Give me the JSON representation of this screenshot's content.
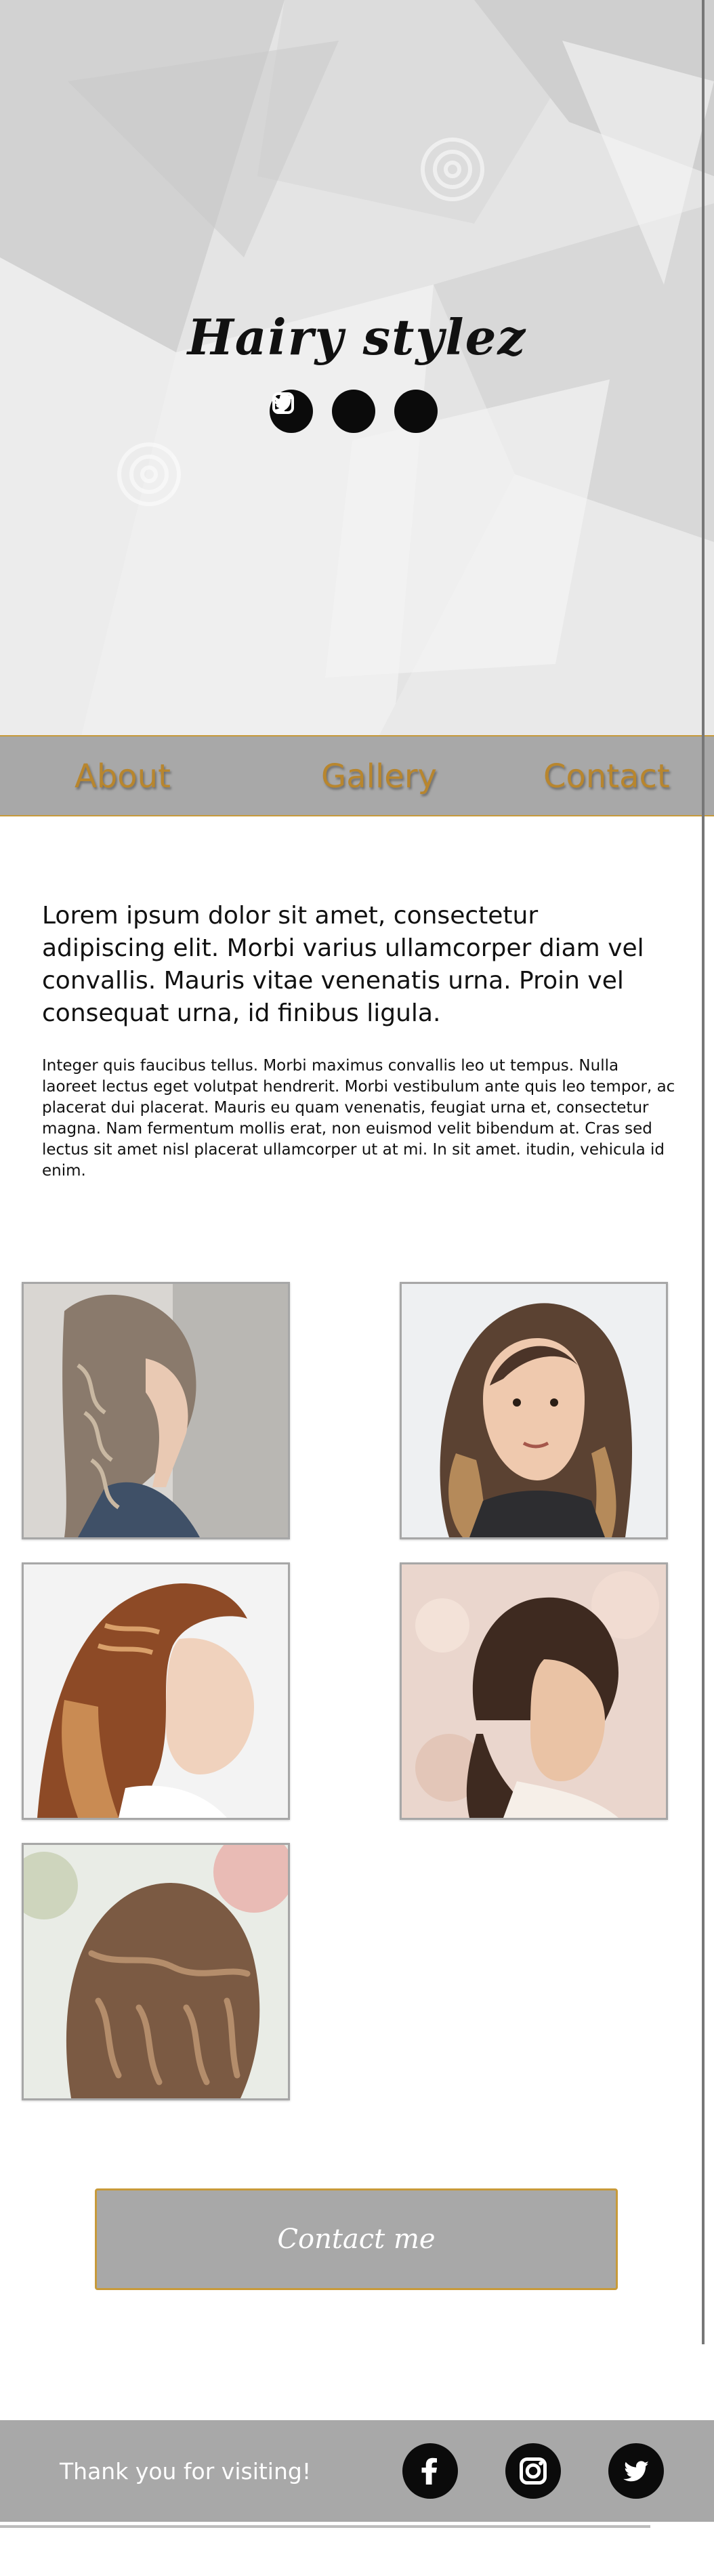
{
  "brand": {
    "name": "Hairy stylez"
  },
  "social": {
    "items": [
      "facebook-icon",
      "instagram-icon",
      "twitter-icon"
    ]
  },
  "nav": {
    "items": [
      {
        "label": "About"
      },
      {
        "label": "Gallery"
      },
      {
        "label": "Contact"
      }
    ]
  },
  "content": {
    "intro": "Lorem ipsum dolor sit amet, consectetur adipiscing elit. Morbi varius ullamcorper diam vel convallis. Mauris vitae venenatis urna. Proin vel consequat urna, id finibus ligula.",
    "body": "Integer quis faucibus tellus. Morbi maximus convallis leo ut tempus. Nulla laoreet lectus eget volutpat hendrerit. Morbi vestibulum ante quis leo tempor, ac placerat dui placerat. Mauris eu quam venenatis, feugiat urna et, consectetur magna. Nam fermentum mollis erat, non euismod velit bibendum at. Cras sed lectus sit amet nisl placerat ullamcorper ut at mi. In sit amet. itudin, vehicula id enim."
  },
  "gallery": {
    "photos": [
      {
        "subject": "side braid profile"
      },
      {
        "subject": "wavy shoulder-length hair"
      },
      {
        "subject": "waterfall braid"
      },
      {
        "subject": "short hair braid"
      },
      {
        "subject": "braided curls back view"
      }
    ]
  },
  "contact": {
    "button_label": "Contact me"
  },
  "footer": {
    "text": "Thank you for visiting!"
  },
  "colors": {
    "accent": "#c79a3a",
    "nav_bg": "#a8a8a8",
    "nav_text": "#b8862e"
  }
}
